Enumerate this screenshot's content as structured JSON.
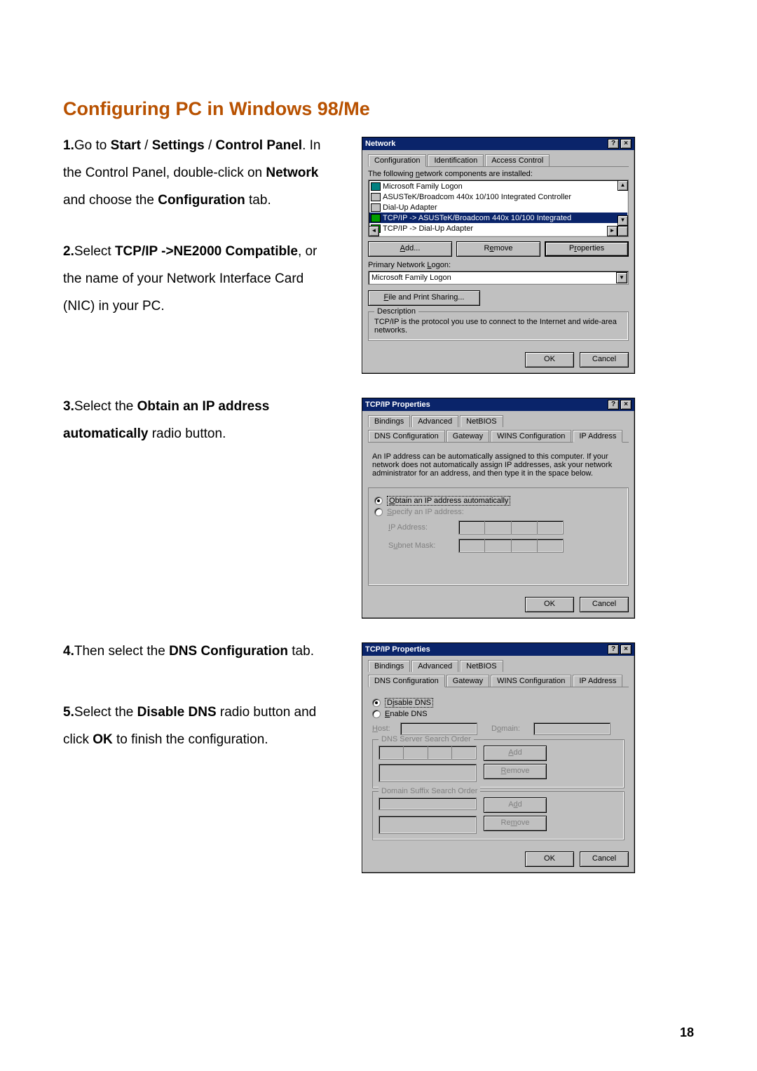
{
  "page_number": "18",
  "heading": "Configuring PC in Windows 98/Me",
  "steps": {
    "s1": {
      "num": "1.",
      "text_a": "Go to ",
      "b1": "Start",
      "sep1": " / ",
      "b2": "Settings",
      "sep2": " / ",
      "b3": "Control Panel",
      "text_b": ". In the Control Panel, double-click on ",
      "b4": "Network",
      "text_c": " and choose the ",
      "b5": "Configuration",
      "text_d": " tab."
    },
    "s2": {
      "num": "2.",
      "text_a": "Select ",
      "b1": "TCP/IP ->NE2000 Compatible",
      "text_b": ", or the name of your Network Interface Card (NIC) in your PC."
    },
    "s3": {
      "num": "3.",
      "text_a": "Select the ",
      "b1": "Obtain an IP address automatically",
      "text_b": " radio button."
    },
    "s4": {
      "num": "4.",
      "text_a": "Then select the ",
      "b1": "DNS Configuration",
      "text_b": " tab."
    },
    "s5": {
      "num": "5.",
      "text_a": "Select the ",
      "b1": "Disable DNS",
      "text_b": " radio button and click ",
      "b2": "OK",
      "text_c": " to finish the configuration."
    }
  },
  "dialog1": {
    "title": "Network",
    "tabs": {
      "t1": "Configuration",
      "t2": "Identification",
      "t3": "Access Control"
    },
    "label_installed": "The following network components are installed:",
    "items": {
      "i1": "Microsoft Family Logon",
      "i2": "ASUSTeK/Broadcom 440x 10/100 Integrated Controller",
      "i3": "Dial-Up Adapter",
      "i4": "TCP/IP -> ASUSTeK/Broadcom 440x 10/100 Integrated",
      "i5": "TCP/IP -> Dial-Up Adapter"
    },
    "buttons": {
      "add": "Add...",
      "remove": "Remove",
      "properties": "Properties"
    },
    "primary_label": "Primary Network Logon:",
    "primary_value": "Microsoft Family Logon",
    "file_print": "File and Print Sharing...",
    "desc_label": "Description",
    "desc_text": "TCP/IP is the protocol you use to connect to the Internet and wide-area networks.",
    "ok": "OK",
    "cancel": "Cancel"
  },
  "dialog2": {
    "title": "TCP/IP Properties",
    "tabs": {
      "t1": "Bindings",
      "t2": "Advanced",
      "t3": "NetBIOS",
      "t4": "DNS Configuration",
      "t5": "Gateway",
      "t6": "WINS Configuration",
      "t7": "IP Address"
    },
    "text": "An IP address can be automatically assigned to this computer. If your network does not automatically assign IP addresses, ask your network administrator for an address, and then type it in the space below.",
    "r1": "Obtain an IP address automatically",
    "r2": "Specify an IP address:",
    "ip_label": "IP Address:",
    "mask_label": "Subnet Mask:",
    "ok": "OK",
    "cancel": "Cancel"
  },
  "dialog3": {
    "title": "TCP/IP Properties",
    "tabs": {
      "t1": "Bindings",
      "t2": "Advanced",
      "t3": "NetBIOS",
      "t4": "DNS Configuration",
      "t5": "Gateway",
      "t6": "WINS Configuration",
      "t7": "IP Address"
    },
    "r1": "Disable DNS",
    "r2": "Enable DNS",
    "host": "Host:",
    "domain": "Domain:",
    "dns_order": "DNS Server Search Order",
    "suffix_order": "Domain Suffix Search Order",
    "add": "Add",
    "remove": "Remove",
    "ok": "OK",
    "cancel": "Cancel"
  }
}
